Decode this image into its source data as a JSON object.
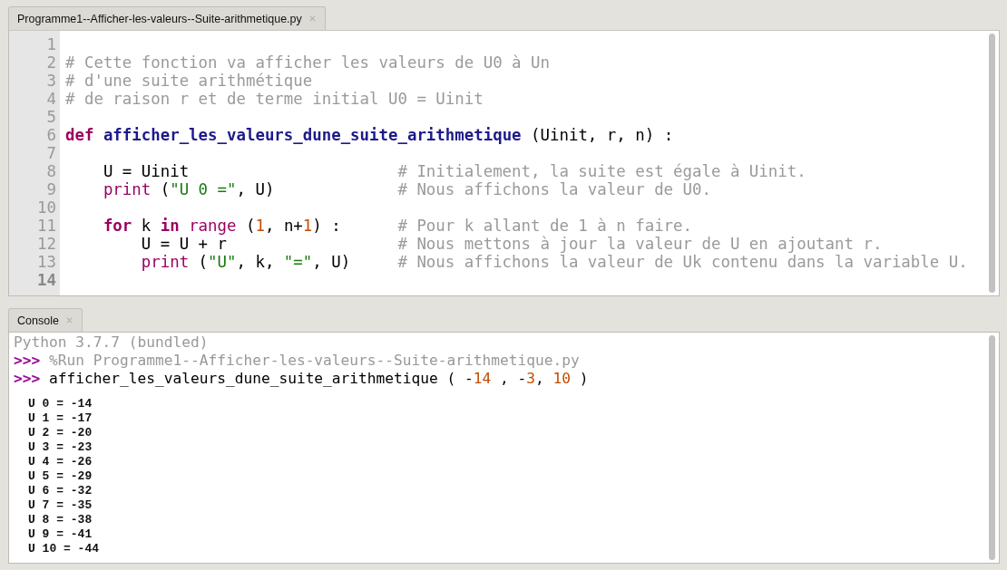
{
  "editor": {
    "tab": {
      "label": "Programme1--Afficher-les-valeurs--Suite-arithmetique.py"
    },
    "lines": [
      {
        "number": "1",
        "current": false
      },
      {
        "number": "2",
        "current": false,
        "code": [
          {
            "kind": "comment",
            "text": "# Cette fonction va afficher les valeurs de U0 à Un"
          }
        ]
      },
      {
        "number": "3",
        "current": false,
        "code": [
          {
            "kind": "comment",
            "text": "# d'une suite arithmétique"
          }
        ]
      },
      {
        "number": "4",
        "current": false,
        "code": [
          {
            "kind": "comment",
            "text": "# de raison r et de terme initial U0 = Uinit"
          }
        ]
      },
      {
        "number": "5",
        "current": false
      },
      {
        "number": "6",
        "current": false,
        "code": [
          {
            "kind": "keyword",
            "text": "def "
          },
          {
            "kind": "funcname",
            "text": "afficher_les_valeurs_dune_suite_arithmetique"
          },
          {
            "kind": "plain",
            "text": " (Uinit, r, n) :"
          }
        ]
      },
      {
        "number": "7",
        "current": false
      },
      {
        "number": "8",
        "current": false,
        "code": [
          {
            "kind": "plain",
            "text": "    U = Uinit"
          }
        ],
        "comment": "# Initialement, la suite est égale à Uinit."
      },
      {
        "number": "9",
        "current": false,
        "code": [
          {
            "kind": "builtin",
            "text": "    print"
          },
          {
            "kind": "plain",
            "text": " ("
          },
          {
            "kind": "string",
            "text": "\"U 0 =\""
          },
          {
            "kind": "plain",
            "text": ", U)"
          }
        ],
        "comment": "# Nous affichons la valeur de U0."
      },
      {
        "number": "10",
        "current": false
      },
      {
        "number": "11",
        "current": false,
        "code": [
          {
            "kind": "keyword",
            "text": "    for"
          },
          {
            "kind": "plain",
            "text": " k "
          },
          {
            "kind": "keyword",
            "text": "in "
          },
          {
            "kind": "builtin",
            "text": "range"
          },
          {
            "kind": "plain",
            "text": " ("
          },
          {
            "kind": "number",
            "text": "1"
          },
          {
            "kind": "plain",
            "text": ", n+"
          },
          {
            "kind": "number",
            "text": "1"
          },
          {
            "kind": "plain",
            "text": ") :"
          }
        ],
        "comment": "# Pour k allant de 1 à n faire."
      },
      {
        "number": "12",
        "current": false,
        "code": [
          {
            "kind": "plain",
            "text": "        U = U + r"
          }
        ],
        "comment": "# Nous mettons à jour la valeur de U en ajoutant r."
      },
      {
        "number": "13",
        "current": false,
        "code": [
          {
            "kind": "builtin",
            "text": "        print"
          },
          {
            "kind": "plain",
            "text": " ("
          },
          {
            "kind": "string",
            "text": "\"U\""
          },
          {
            "kind": "plain",
            "text": ", k, "
          },
          {
            "kind": "string",
            "text": "\"=\""
          },
          {
            "kind": "plain",
            "text": ", U)"
          }
        ],
        "comment": "# Nous affichons la valeur de Uk contenu dans la variable U."
      },
      {
        "number": "14",
        "current": true
      }
    ]
  },
  "console": {
    "tab": {
      "label": "Console"
    },
    "lines": [
      {
        "kind": "info",
        "text": "Python 3.7.7 (bundled)"
      },
      {
        "kind": "magic",
        "prompt": ">>>",
        "text": "%Run Programme1--Afficher-les-valeurs--Suite-arithmetique.py"
      },
      {
        "kind": "command",
        "prompt": ">>>",
        "tokens": [
          {
            "kind": "plain",
            "text": "afficher_les_valeurs_dune_suite_arithmetique ( -"
          },
          {
            "kind": "number",
            "text": "14"
          },
          {
            "kind": "plain",
            "text": " , -"
          },
          {
            "kind": "number",
            "text": "3"
          },
          {
            "kind": "plain",
            "text": ", "
          },
          {
            "kind": "number",
            "text": "10"
          },
          {
            "kind": "plain",
            "text": " )"
          }
        ]
      }
    ],
    "output": [
      "U 0 = -14",
      "U 1 = -17",
      "U 2 = -20",
      "U 3 = -23",
      "U 4 = -26",
      "U 5 = -29",
      "U 6 = -32",
      "U 7 = -35",
      "U 8 = -38",
      "U 9 = -41",
      "U 10 = -44"
    ]
  }
}
